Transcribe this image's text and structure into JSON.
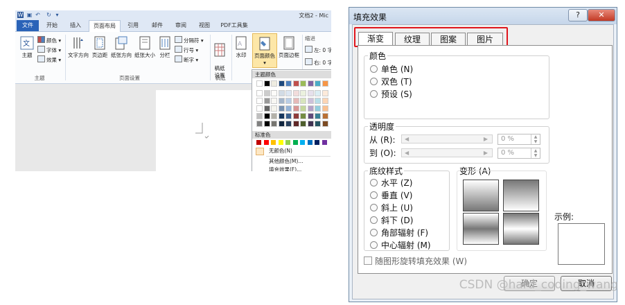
{
  "word": {
    "doc_title": "文档2 - Mic",
    "tabs": [
      "文件",
      "开始",
      "插入",
      "页面布局",
      "引用",
      "邮件",
      "审阅",
      "视图",
      "PDF工具集"
    ],
    "ribbon": {
      "theme_label": "主题",
      "colors_label": "颜色",
      "fonts_label": "字体",
      "effects_label": "效果",
      "text_direction": "文字方向",
      "margins": "页边距",
      "orientation": "纸张方向",
      "size": "纸张大小",
      "columns": "分栏",
      "breaks": "分隔符",
      "line_numbers": "行号",
      "hyphenation": "断字",
      "draft_settings": "稿纸\n设置",
      "watermark": "水印",
      "page_color": "页面颜色",
      "page_borders": "页面边框",
      "indent": "缩进",
      "indent_left": "左: 0 字",
      "indent_right": "右: 0 字",
      "group_theme": "主题",
      "group_page_setup": "页面设置",
      "group_draft": "稿纸"
    },
    "color_dropdown": {
      "theme_colors_header": "主题颜色",
      "standard_colors_header": "标准色",
      "no_color": "无颜色(N)",
      "more_colors": "其他颜色(M)...",
      "fill_effects": "填充效果(F)...",
      "theme_colors": [
        "#ffffff",
        "#000000",
        "#eeece1",
        "#1f497d",
        "#4f81bd",
        "#c0504d",
        "#9bbb59",
        "#8064a2",
        "#4bacc6",
        "#f79646"
      ],
      "standard_colors": [
        "#c00000",
        "#ff0000",
        "#ffc000",
        "#ffff00",
        "#92d050",
        "#00b050",
        "#00b0f0",
        "#0070c0",
        "#002060",
        "#7030a0"
      ]
    }
  },
  "dialog": {
    "title": "填充效果",
    "help_button": "?",
    "close_button": "✕",
    "tabs": [
      "渐变",
      "纹理",
      "图案",
      "图片"
    ],
    "colors_group": "颜色",
    "color_options": [
      "单色 (N)",
      "双色 (T)",
      "预设 (S)"
    ],
    "transparency_group": "透明度",
    "from_label": "从 (R):",
    "to_label": "到 (O):",
    "from_value": "0 %",
    "to_value": "0 %",
    "shading_group": "底纹样式",
    "shading_options": [
      "水平 (Z)",
      "垂直 (V)",
      "斜上 (U)",
      "斜下 (D)",
      "角部辐射 (F)",
      "中心辐射 (M)"
    ],
    "variants_label": "变形 (A)",
    "sample_label": "示例:",
    "rotate_checkbox": "随图形旋转填充效果 (W)",
    "ok_button": "确定",
    "cancel_button": "取消"
  },
  "watermark_text": "CSDN @hard_coding_wang"
}
